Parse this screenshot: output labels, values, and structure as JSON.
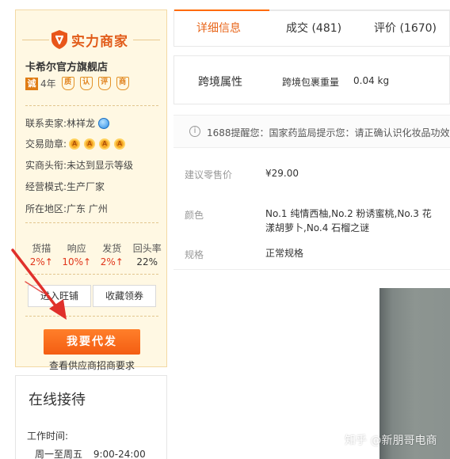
{
  "seller": {
    "badge_label": "实力商家",
    "shop_name": "卡希尔官方旗舰店",
    "cheng_badge": "诚",
    "years": "4年",
    "cert_icons": [
      "质",
      "认",
      "评",
      "商"
    ],
    "contact_label": "联系卖家:",
    "contact_name": "林祥龙",
    "medals_label": "交易勋章:",
    "medal_glyph": "A",
    "rank_label": "实商头衔:",
    "rank_value": "未达到显示等级",
    "mode_label": "经营模式:",
    "mode_value": "生产厂家",
    "region_label": "所在地区:",
    "region_value": "广东 广州",
    "stats_headers": [
      "货描",
      "响应",
      "发货",
      "回头率"
    ],
    "stats_values": [
      "2%↑",
      "10%↑",
      "2%↑",
      "22%"
    ],
    "want_button": "进入旺铺",
    "coupon_button": "收藏领券",
    "resale_button": "我要代发",
    "requirements_link": "查看供应商招商要求"
  },
  "service": {
    "title": "在线接待",
    "hours_label": "工作时间:",
    "days": "周一至周五",
    "time": "9:00-24:00"
  },
  "tabs": [
    {
      "label": "详细信息"
    },
    {
      "label": "成交 (481)"
    },
    {
      "label": "评价 (1670)"
    }
  ],
  "cross_border": {
    "title": "跨境属性",
    "key": "跨境包裹重量",
    "value": "0.04 kg"
  },
  "notice": {
    "text": "1688提醒您：国家药监局提示您：请正确认识化妆品功效，"
  },
  "attributes": [
    {
      "key": "建议零售价",
      "value": "¥29.00"
    },
    {
      "key": "颜色",
      "value_line1": "No.1 纯情西柚,No.2 粉诱蜜桃,No.3 花",
      "value_line2": "漾胡萝卜,No.4 石榴之谜"
    },
    {
      "key": "规格",
      "value": "正常规格"
    }
  ],
  "watermark": "知乎 @新朋哥电商",
  "colors": {
    "accent": "#ff6a00",
    "badge_text": "#e15b19",
    "stat_red": "#e1361b",
    "panel_bg": "#fff8e3"
  }
}
